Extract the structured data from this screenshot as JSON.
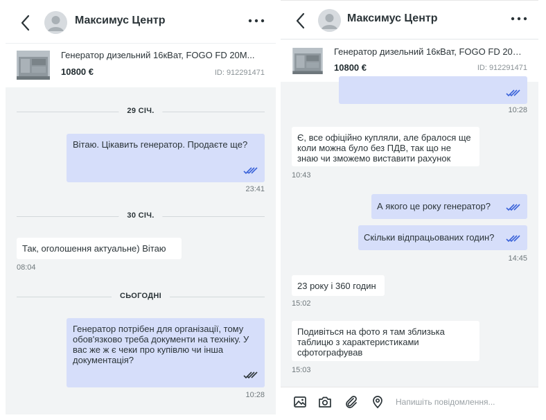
{
  "header": {
    "title": "Максимус Центр"
  },
  "product": {
    "name": "Генератор дизельний 16кВат, FOGO FD 20M...",
    "price": "10800 €",
    "id": "ID: 912291471"
  },
  "panel1": {
    "sep1": "29 СІЧ.",
    "m1": "Вітаю. Цікавить генератор. Продаєте ще?",
    "t1": "23:41",
    "sep2": "30 СІЧ.",
    "m2": "Так, оголошення актуальне) Вітаю",
    "t2": "08:04",
    "sep3": "СЬОГОДНІ",
    "m3": "Генератор потрібен для організації, тому обов'язково треба документи на техніку. У вас же ж є чеки про купівлю чи інша документація?",
    "t3": "10:28"
  },
  "panel2": {
    "t0": "10:28",
    "m1": "Є, все офіційно купляли, але бралося ще коли можна було без ПДВ, так що не знаю чи зможемо виставити рахунок",
    "t1": "10:43",
    "m2": "А якого це року генератор?",
    "m3": "Скільки відпрацьованих годин?",
    "t3": "14:45",
    "m4": "23 року і 360 годин",
    "t4": "15:02",
    "m5": "Подивіться на фото я там зблизька таблицю з характеристиками сфотографував",
    "t5": "15:03"
  },
  "composer": {
    "placeholder": "Напишіть повідомлення..."
  },
  "icons": {
    "back": "chevron-left-icon",
    "more": "more-horizontal-icon",
    "check": "double-check-icon",
    "image": "image-icon",
    "camera": "camera-icon",
    "attach": "paperclip-icon",
    "location": "location-pin-icon"
  },
  "colors": {
    "outgoing_bubble": "#d6defa",
    "incoming_bubble": "#ffffff",
    "chat_background": "#f2f4f5",
    "read_check": "#3b63d9"
  }
}
